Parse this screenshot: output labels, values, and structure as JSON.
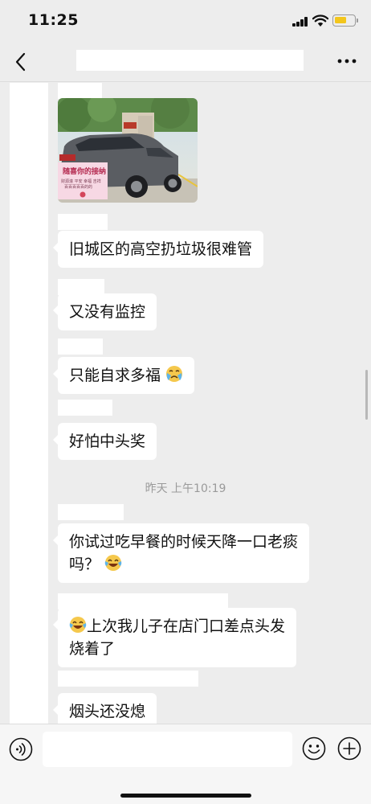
{
  "status_bar": {
    "time": "11:25",
    "battery_level": 0.62,
    "battery_color": "#f3c61c"
  },
  "nav": {
    "back_icon": "chevron-left-icon",
    "more_icon": "more-icon"
  },
  "chat": {
    "photo": {
      "card_title": "随喜你的接纳",
      "card_line1": "财源滚 平安 幸福 吉祥",
      "card_line2": "百百百百百的的"
    },
    "messages": [
      {
        "text": "旧城区的高空扔垃圾很难管",
        "emoji": ""
      },
      {
        "text": "又没有监控",
        "emoji": ""
      },
      {
        "text": "只能自求多福",
        "emoji": "crying-face-emoji"
      },
      {
        "text": "好怕中头奖",
        "emoji": ""
      }
    ],
    "timestamp": "昨天 上午10:19",
    "messages_after": [
      {
        "line1": "你试过吃早餐的时候天降一口老痰",
        "line2": "吗？"
      },
      {
        "line1": "上次我儿子在店门口差点头发",
        "line2": "烧着了"
      },
      {
        "text": "烟头还没熄"
      }
    ]
  },
  "input_bar": {
    "placeholder": "",
    "voice_icon": "voice-icon",
    "emoji_icon": "smiley-icon",
    "plus_icon": "plus-icon"
  }
}
